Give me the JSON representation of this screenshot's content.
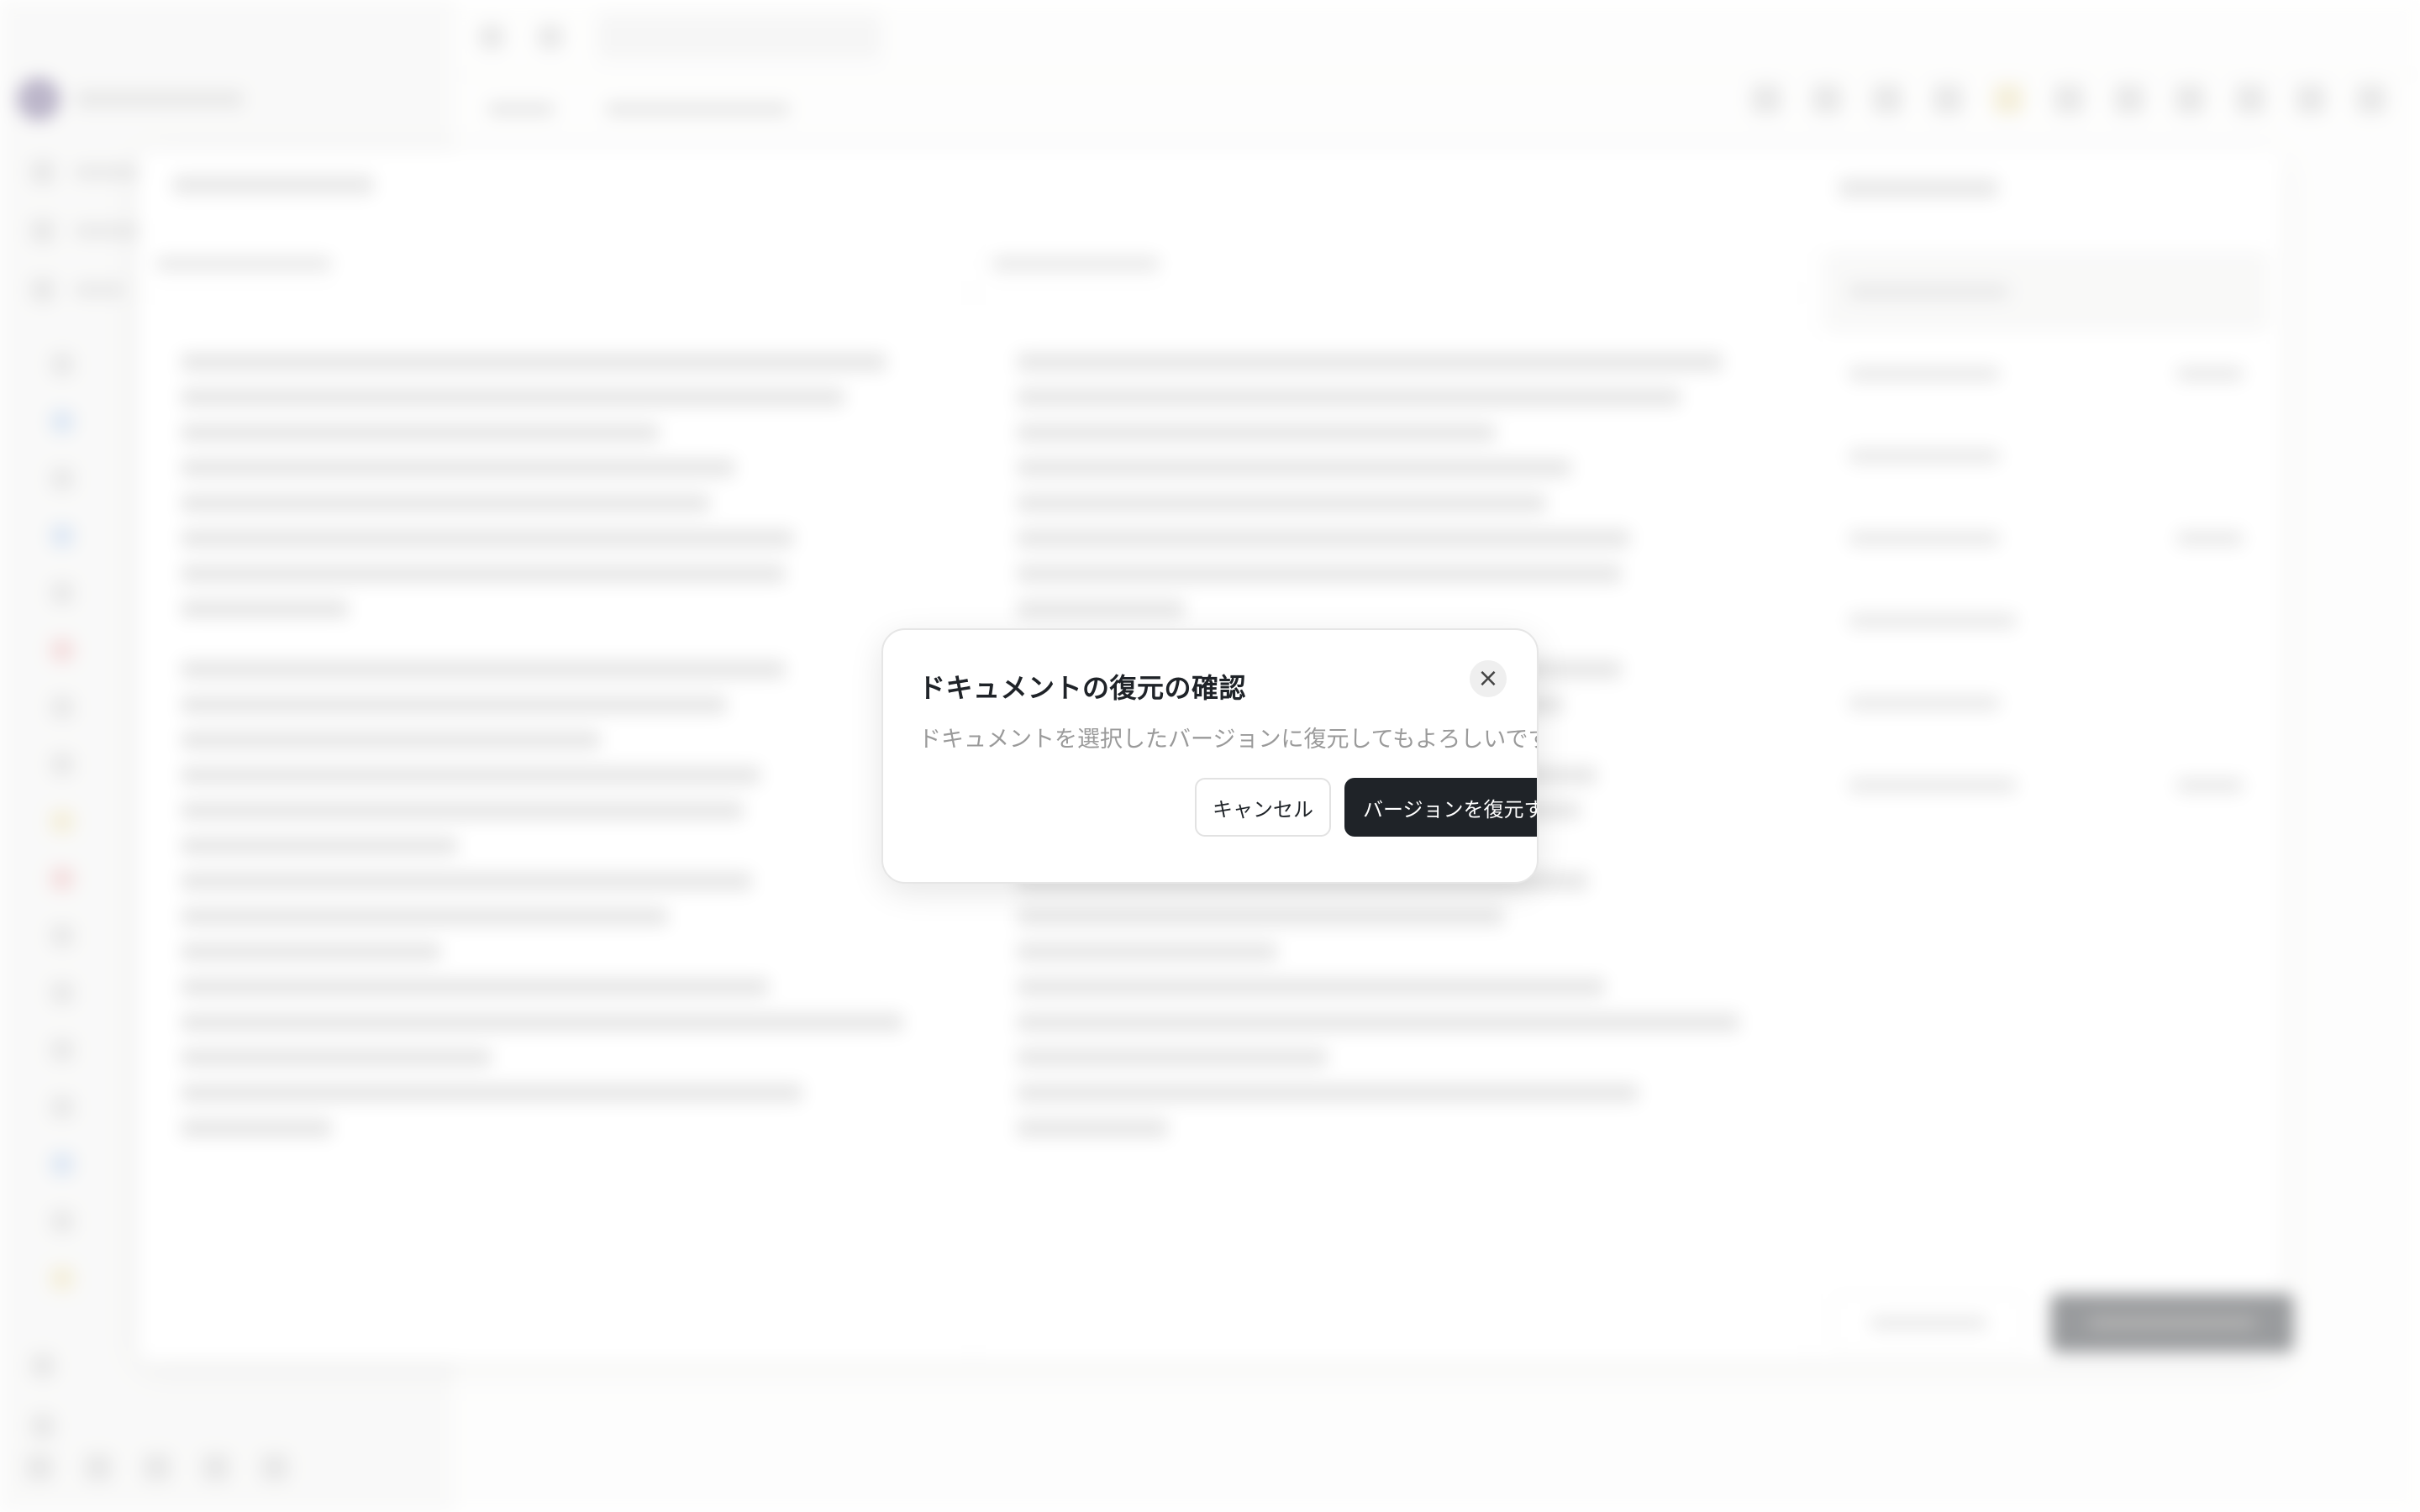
{
  "dialog": {
    "title": "ドキュメントの復元の確認",
    "description": "ドキュメントを選択したバージョンに復元してもよろしいですか？",
    "close_label": "×",
    "cancel_label": "キャンセル",
    "restore_label": "バージョンを復元する"
  },
  "icons": {
    "close": "close-icon"
  }
}
